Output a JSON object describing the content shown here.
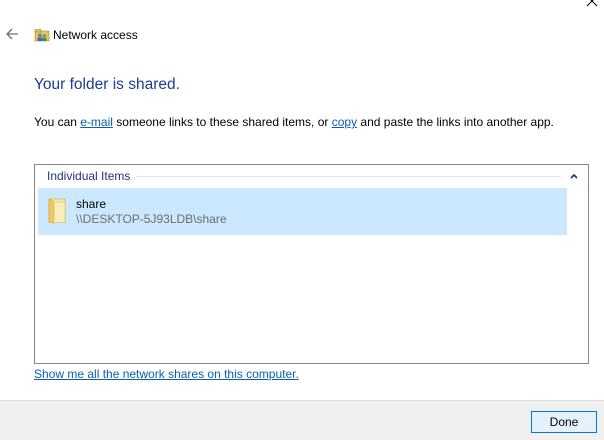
{
  "window": {
    "title": "Network access",
    "icon": "network-share-folder-icon"
  },
  "heading": "Your folder is shared.",
  "description": {
    "prefix": "You can ",
    "email_link": "e-mail",
    "middle": " someone links to these shared items, or ",
    "copy_link": "copy",
    "suffix": " and paste the links into another app."
  },
  "items": {
    "group_label": "Individual Items",
    "rows": [
      {
        "name": "share",
        "path": "\\\\DESKTOP-5J93LDB\\share",
        "icon": "folder-icon",
        "selected": true
      }
    ]
  },
  "show_shares_link": "Show me all the network shares on this computer.",
  "footer": {
    "done_label": "Done"
  },
  "colors": {
    "heading": "#1c3c92",
    "link": "#0a5fb0",
    "selection": "#cce8ff",
    "footer_bg": "#f0f0f0",
    "button_border": "#0078d7"
  }
}
